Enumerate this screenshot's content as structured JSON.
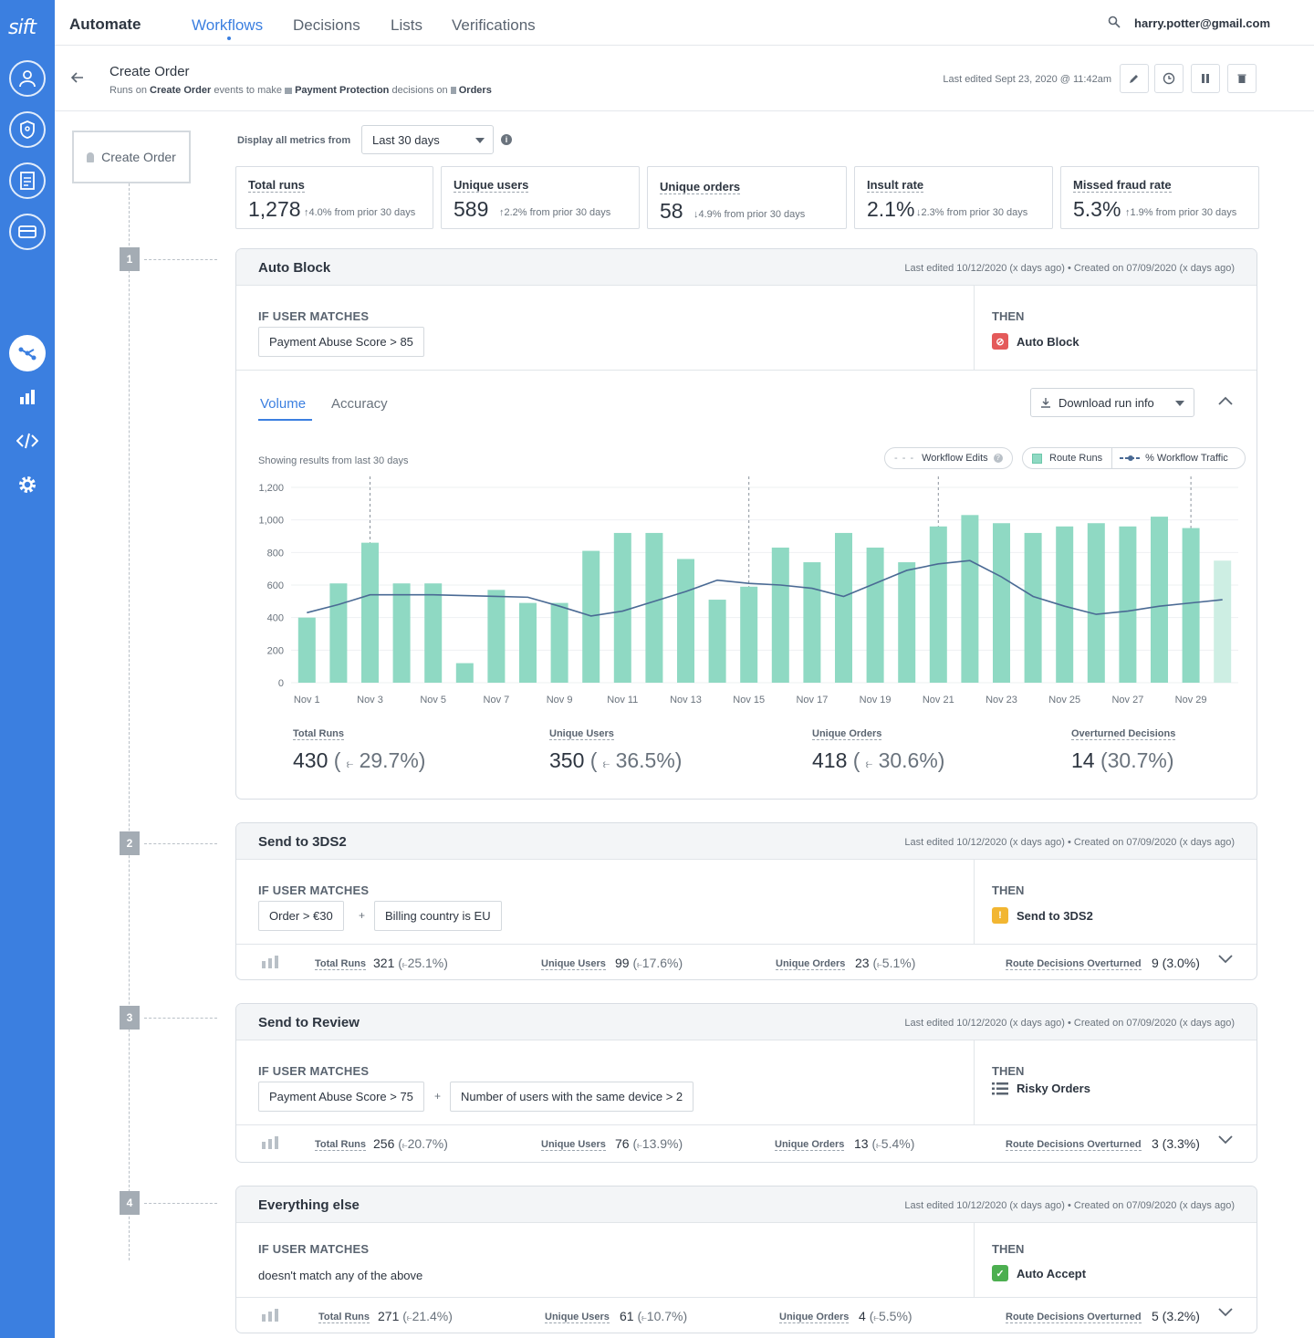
{
  "app": {
    "logo": "sift",
    "section": "Automate",
    "user_email": "harry.potter@gmail.com"
  },
  "nav": [
    "Workflows",
    "Decisions",
    "Lists",
    "Verifications"
  ],
  "workflow": {
    "title": "Create Order",
    "sub_prefix": "Runs on",
    "event": "Create Order",
    "sub_mid": "events to make",
    "decision_type": "Payment Protection",
    "sub_mid2": "decisions on",
    "entity": "Orders",
    "last_edited": "Last edited Sept 23, 2020 @ 11:42am"
  },
  "start_node": "Create Order",
  "filter": {
    "label": "Display all metrics from",
    "value": "Last 30 days"
  },
  "metrics": [
    {
      "label": "Total runs",
      "value": "1,278",
      "change": "4.0% from prior 30 days",
      "dir": "up"
    },
    {
      "label": "Unique users",
      "value": "589",
      "change": "2.2% from prior 30 days",
      "dir": "up"
    },
    {
      "label": "Unique orders",
      "value": "58",
      "change": "4.9% from prior 30 days",
      "dir": "down"
    },
    {
      "label": "Insult rate",
      "value": "2.1%",
      "change": "2.3% from prior 30 days",
      "dir": "down"
    },
    {
      "label": "Missed fraud rate",
      "value": "5.3%",
      "change": "1.9% from prior 30 days",
      "dir": "up"
    }
  ],
  "labels": {
    "if_user_matches": "IF USER MATCHES",
    "then": "THEN",
    "plus": "+"
  },
  "routes": [
    {
      "step": "1",
      "title": "Auto Block",
      "meta": "Last edited 10/12/2020 (x days ago) • Created on 07/09/2020 (x days ago)",
      "conditions": [
        "Payment Abuse Score > 85"
      ],
      "action": "Auto Block",
      "tabs": [
        "Volume",
        "Accuracy"
      ],
      "download_label": "Download run info",
      "showing": "Showing results from last 30 days",
      "legend": {
        "edits": "Workflow Edits",
        "runs": "Route Runs",
        "traffic": "% Workflow Traffic"
      },
      "big_stats": [
        {
          "label": "Total Runs",
          "value": "430",
          "pct": "29.7%"
        },
        {
          "label": "Unique Users",
          "value": "350",
          "pct": "36.5%"
        },
        {
          "label": "Unique Orders",
          "value": "418",
          "pct": "30.6%"
        },
        {
          "label": "Overturned Decisions",
          "value": "14",
          "pct": "(30.7%)"
        }
      ]
    },
    {
      "step": "2",
      "title": "Send to 3DS2",
      "meta": "Last edited 10/12/2020 (x days ago) • Created on 07/09/2020 (x days ago)",
      "conditions": [
        "Order > €30",
        "Billing country is EU"
      ],
      "action": "Send to 3DS2",
      "stats": {
        "total_runs_label": "Total Runs",
        "total_runs": "321",
        "total_runs_pct": "25.1%",
        "users_label": "Unique Users",
        "users": "99",
        "users_pct": "17.6%",
        "orders_label": "Unique Orders",
        "orders": "23",
        "orders_pct": "5.1%",
        "overturned_label": "Route Decisions Overturned",
        "overturned": "9 (3.0%)"
      }
    },
    {
      "step": "3",
      "title": "Send to Review",
      "meta": "Last edited 10/12/2020 (x days ago) • Created on 07/09/2020 (x days ago)",
      "conditions": [
        "Payment Abuse Score > 75",
        "Number of users with the same device > 2"
      ],
      "action": "Risky Orders",
      "stats": {
        "total_runs_label": "Total Runs",
        "total_runs": "256",
        "total_runs_pct": "20.7%",
        "users_label": "Unique Users",
        "users": "76",
        "users_pct": "13.9%",
        "orders_label": "Unique Orders",
        "orders": "13",
        "orders_pct": "5.4%",
        "overturned_label": "Route Decisions Overturned",
        "overturned": "3 (3.3%)"
      }
    },
    {
      "step": "4",
      "title": "Everything else",
      "meta": "Last edited 10/12/2020 (x days ago) • Created on 07/09/2020 (x days ago)",
      "condition_text": "doesn't match any of the above",
      "action": "Auto Accept",
      "stats": {
        "total_runs_label": "Total Runs",
        "total_runs": "271",
        "total_runs_pct": "21.4%",
        "users_label": "Unique Users",
        "users": "61",
        "users_pct": "10.7%",
        "orders_label": "Unique Orders",
        "orders": "4",
        "orders_pct": "5.5%",
        "overturned_label": "Route Decisions Overturned",
        "overturned": "5 (3.2%)"
      }
    }
  ],
  "colors": {
    "accent": "#3b7fe0",
    "bar": "#8fd9c3",
    "bar_last": "#cdeee3",
    "line": "#4a6a94",
    "block": "#e45a5a",
    "warn": "#f2b632",
    "accept": "#4caf50"
  },
  "chart_data": {
    "type": "bar",
    "x_ticks": [
      "Nov 1",
      "Nov 3",
      "Nov 5",
      "Nov 7",
      "Nov 9",
      "Nov 11",
      "Nov 13",
      "Nov 15",
      "Nov 17",
      "Nov 19",
      "Nov 21",
      "Nov 23",
      "Nov 25",
      "Nov 27",
      "Nov 29"
    ],
    "y_ticks": [
      "0",
      "200",
      "400",
      "600",
      "800",
      "1,000",
      "1,200"
    ],
    "ylim": [
      0,
      1200
    ],
    "series": [
      {
        "name": "Route Runs",
        "type": "bar",
        "values": [
          400,
          610,
          860,
          610,
          610,
          120,
          570,
          490,
          490,
          810,
          920,
          920,
          760,
          510,
          590,
          830,
          740,
          920,
          830,
          740,
          960,
          1030,
          980,
          920,
          960,
          980,
          960,
          1020,
          950,
          750
        ]
      },
      {
        "name": "% Workflow Traffic",
        "type": "line",
        "values": [
          430,
          480,
          540,
          540,
          540,
          535,
          530,
          525,
          470,
          410,
          440,
          500,
          560,
          630,
          610,
          600,
          580,
          530,
          610,
          690,
          730,
          750,
          650,
          530,
          470,
          420,
          440,
          470,
          490,
          510
        ]
      }
    ],
    "workflow_edit_indices": [
      2,
      14,
      20,
      28
    ]
  }
}
